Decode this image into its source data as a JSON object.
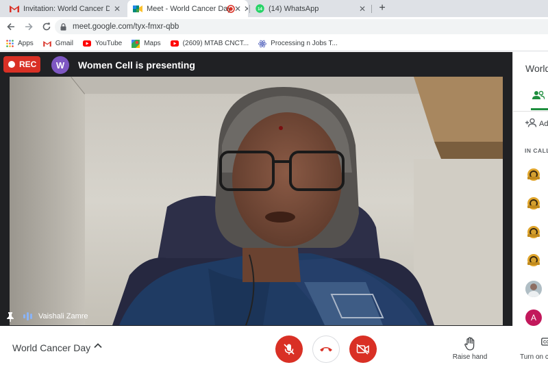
{
  "browser": {
    "tabs": [
      {
        "title": "Invitation: World Cancer Day @ T",
        "icon": "gmail-icon"
      },
      {
        "title": "Meet - World Cancer Day",
        "icon": "meet-icon"
      },
      {
        "title": "",
        "icon": "recording-icon"
      },
      {
        "title": "(14) WhatsApp",
        "icon": "whatsapp-icon"
      }
    ],
    "url": "meet.google.com/tyx-fmxr-qbb",
    "bookmarks": [
      {
        "label": "Apps",
        "icon": "apps-grid-icon"
      },
      {
        "label": "Gmail",
        "icon": "gmail-icon"
      },
      {
        "label": "YouTube",
        "icon": "youtube-icon"
      },
      {
        "label": "Maps",
        "icon": "maps-icon"
      },
      {
        "label": "(2609) MTAB CNCT...",
        "icon": "youtube-icon"
      },
      {
        "label": "Processing n Jobs T...",
        "icon": "atom-icon"
      }
    ]
  },
  "meet": {
    "rec_label": "REC",
    "presenter_initial": "W",
    "presenting_text": "Women Cell is presenting",
    "video_participant_name": "Vaishali Zamre",
    "meeting_title": "World Cancer Day",
    "actions": {
      "raise_hand": "Raise hand",
      "turn_on_captions": "Turn on c"
    }
  },
  "panel": {
    "title": "World",
    "add_people": "Ad",
    "in_call_label": "IN CALL",
    "participants": [
      {
        "type": "emblem"
      },
      {
        "type": "emblem"
      },
      {
        "type": "emblem"
      },
      {
        "type": "emblem"
      },
      {
        "type": "photo"
      },
      {
        "type": "initial",
        "initial": "A"
      }
    ]
  },
  "colors": {
    "rec_red": "#d93025",
    "meet_dark": "#202124",
    "panel_green": "#1e8e3e",
    "speaking_blue": "#8ab4f8",
    "avatar_purple": "#7e57c2",
    "avatar_pink": "#c2185b"
  }
}
